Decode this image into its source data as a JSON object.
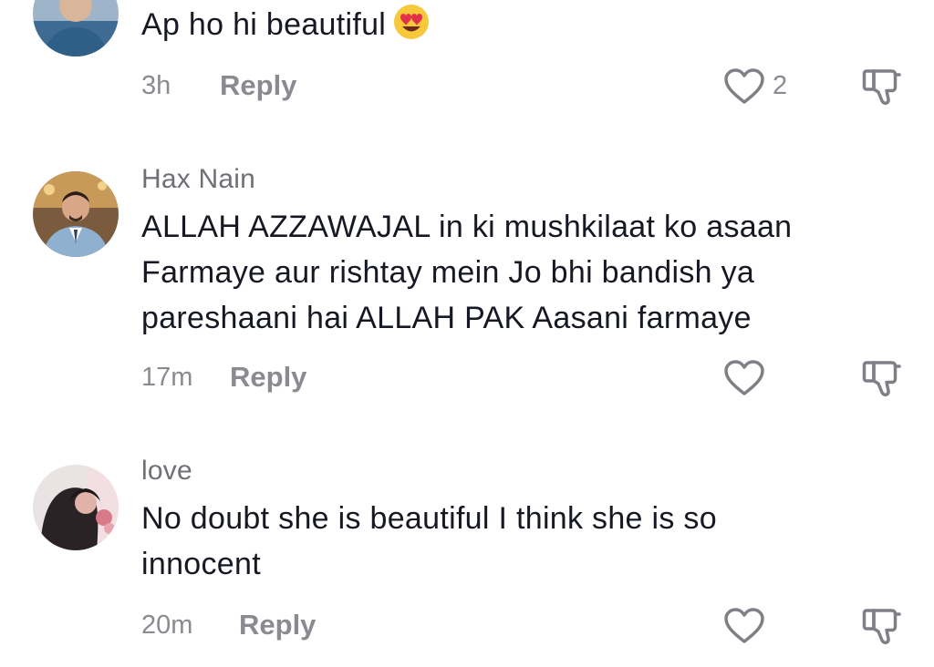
{
  "comments": [
    {
      "username": "",
      "text": "Ap ho hi beautiful",
      "emoji": "heart-eyes-emoji",
      "time": "3h",
      "reply_label": "Reply",
      "like_count": "2"
    },
    {
      "username": "Hax Nain",
      "text": "ALLAH AZZAWAJAL in ki mushkilaat ko asaan Farmaye aur rishtay mein Jo bhi bandish ya pareshaani hai ALLAH PAK Aasani farmaye",
      "time": "17m",
      "reply_label": "Reply",
      "like_count": ""
    },
    {
      "username": "love",
      "text": "No doubt she is beautiful I think she is so innocent",
      "time": "20m",
      "reply_label": "Reply",
      "like_count": ""
    }
  ],
  "icons": {
    "like": "heart-outline-icon",
    "dislike": "thumbs-down-icon"
  },
  "colors": {
    "text": "#161823",
    "secondary": "#8a8b91",
    "username": "#6f7075",
    "background": "#ffffff"
  }
}
